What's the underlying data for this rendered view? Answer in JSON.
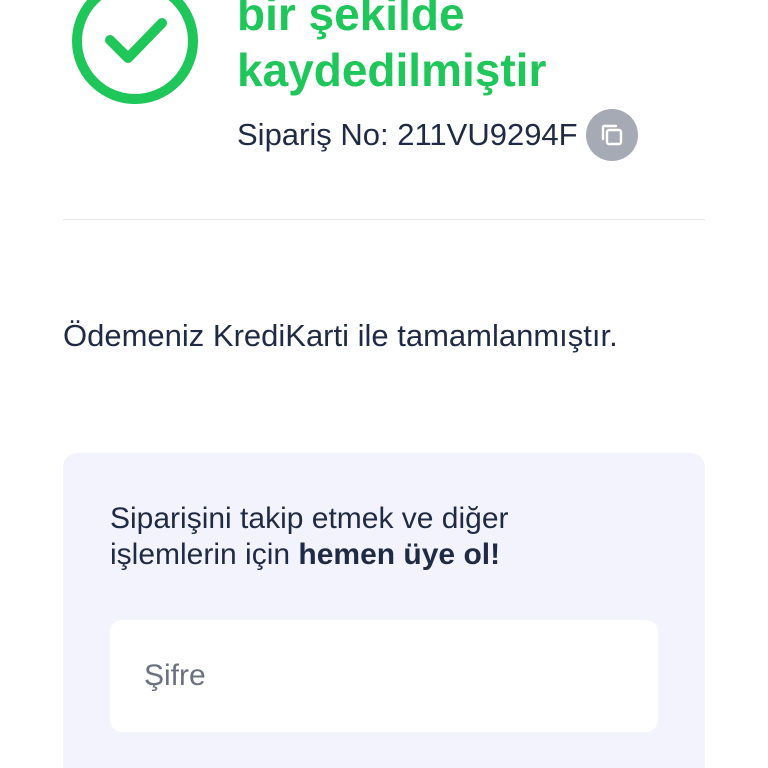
{
  "success": {
    "title_line1": "bir şekilde",
    "title_line2": "kaydedilmiştir",
    "color": "#1fc65a",
    "icon": "check-circle-icon"
  },
  "order": {
    "label": "Sipariş No: 211VU9294F",
    "copy_icon": "copy-icon"
  },
  "payment": {
    "message": "Ödemeniz KrediKarti ile tamamlanmıştır."
  },
  "signup": {
    "text_line1": "Siparişini takip etmek ve diğer",
    "text_line2_prefix": "işlemlerin için ",
    "text_line2_bold": "hemen üye ol!",
    "password_placeholder": "Şifre"
  }
}
